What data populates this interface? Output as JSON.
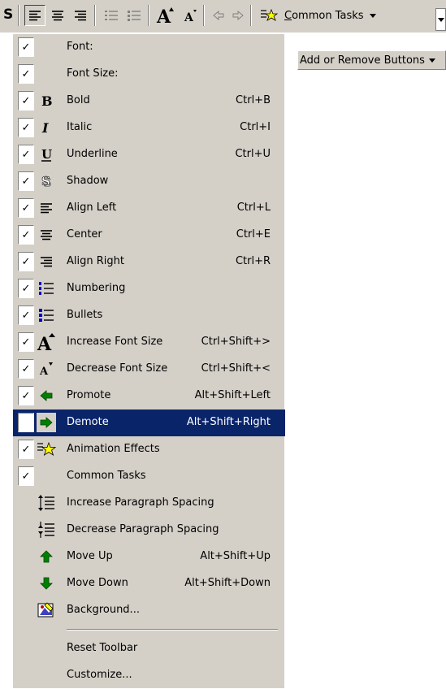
{
  "toolbar": {
    "common_tasks_label": "Common Tasks",
    "common_tasks_accel": "C"
  },
  "add_remove_label": "Add or Remove Buttons",
  "menu": [
    {
      "label": "Font:",
      "shortcut": "",
      "checked": true,
      "icon": "none"
    },
    {
      "label": "Font Size:",
      "shortcut": "",
      "checked": true,
      "icon": "none"
    },
    {
      "label": "Bold",
      "shortcut": "Ctrl+B",
      "checked": true,
      "icon": "bold-icon"
    },
    {
      "label": "Italic",
      "shortcut": "Ctrl+I",
      "checked": true,
      "icon": "italic-icon"
    },
    {
      "label": "Underline",
      "shortcut": "Ctrl+U",
      "checked": true,
      "icon": "underline-icon"
    },
    {
      "label": "Shadow",
      "shortcut": "",
      "checked": true,
      "icon": "shadow-icon"
    },
    {
      "label": "Align Left",
      "shortcut": "Ctrl+L",
      "checked": true,
      "icon": "align-left-icon"
    },
    {
      "label": "Center",
      "shortcut": "Ctrl+E",
      "checked": true,
      "icon": "align-center-icon"
    },
    {
      "label": "Align Right",
      "shortcut": "Ctrl+R",
      "checked": true,
      "icon": "align-right-icon"
    },
    {
      "label": "Numbering",
      "shortcut": "",
      "checked": true,
      "icon": "numbering-icon"
    },
    {
      "label": "Bullets",
      "shortcut": "",
      "checked": true,
      "icon": "bullets-icon"
    },
    {
      "label": "Increase Font Size",
      "shortcut": "Ctrl+Shift+>",
      "checked": true,
      "icon": "increase-font-icon"
    },
    {
      "label": "Decrease Font Size",
      "shortcut": "Ctrl+Shift+<",
      "checked": true,
      "icon": "decrease-font-icon"
    },
    {
      "label": "Promote",
      "shortcut": "Alt+Shift+Left",
      "checked": true,
      "icon": "promote-icon"
    },
    {
      "label": "Demote",
      "shortcut": "Alt+Shift+Right",
      "checked": true,
      "icon": "demote-icon",
      "highlighted": true
    },
    {
      "label": "Animation Effects",
      "shortcut": "",
      "checked": true,
      "icon": "animation-effects-icon"
    },
    {
      "label": "Common Tasks",
      "shortcut": "",
      "checked": true,
      "icon": "none"
    },
    {
      "label": "Increase Paragraph Spacing",
      "shortcut": "",
      "checked": false,
      "icon": "increase-paragraph-spacing-icon"
    },
    {
      "label": "Decrease Paragraph Spacing",
      "shortcut": "",
      "checked": false,
      "icon": "decrease-paragraph-spacing-icon"
    },
    {
      "label": "Move Up",
      "shortcut": "Alt+Shift+Up",
      "checked": false,
      "icon": "move-up-icon"
    },
    {
      "label": "Move Down",
      "shortcut": "Alt+Shift+Down",
      "checked": false,
      "icon": "move-down-icon"
    },
    {
      "label": "Background...",
      "shortcut": "",
      "checked": false,
      "icon": "background-icon"
    },
    {
      "label": "Reset Toolbar",
      "shortcut": "",
      "checked": false,
      "icon": "none"
    },
    {
      "label": "Customize...",
      "shortcut": "",
      "checked": false,
      "icon": "none"
    }
  ],
  "check_glyph": "✓",
  "colors": {
    "highlight": "#0a246a",
    "face": "#d4d0c8",
    "arrow_green": "#008000",
    "star_yellow": "#ffff00"
  }
}
